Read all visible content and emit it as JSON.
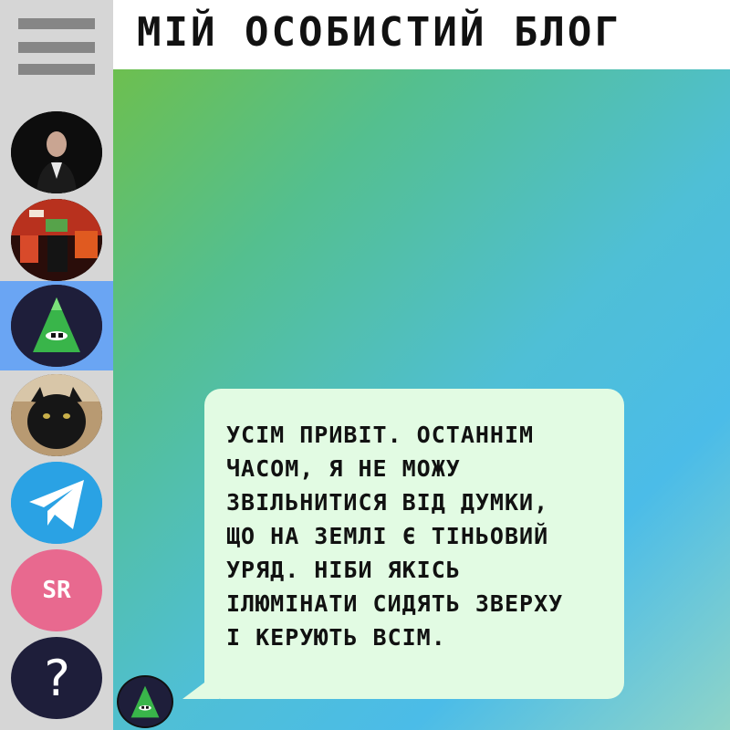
{
  "header": {
    "title": "МІЙ ОСОБИСТИЙ БЛОГ"
  },
  "sidebar": {
    "menu_icon": "hamburger-menu-icon",
    "chats": [
      {
        "id": "portrait",
        "icon": "portrait-avatar"
      },
      {
        "id": "red-art",
        "icon": "red-artwork-avatar"
      },
      {
        "id": "illuminati",
        "icon": "green-pyramid-avatar",
        "active": true
      },
      {
        "id": "cat",
        "icon": "black-cat-avatar"
      },
      {
        "id": "telegram",
        "icon": "telegram-icon"
      },
      {
        "id": "sr",
        "label": "SR"
      },
      {
        "id": "help",
        "label": "?"
      }
    ]
  },
  "message": {
    "text": "УСІМ ПРИВІТ. ОСТАННІМ\nЧАСОМ, Я НЕ МОЖУ\nЗВІЛЬНИТИСЯ ВІД ДУМКИ,\nЩО НА ЗЕМЛІ Є ТІНЬОВИЙ\nУРЯД. НІБИ ЯКІСЬ\nІЛЮМІНАТИ СИДЯТЬ ЗВЕРХУ\nІ КЕРУЮТЬ ВСІМ."
  },
  "colors": {
    "sidebar_bg": "#d6d6d6",
    "active_item": "#6aa5f3",
    "bubble_bg": "#e2fbe3",
    "sr_avatar": "#e8698f",
    "telegram": "#2aa2e4"
  }
}
